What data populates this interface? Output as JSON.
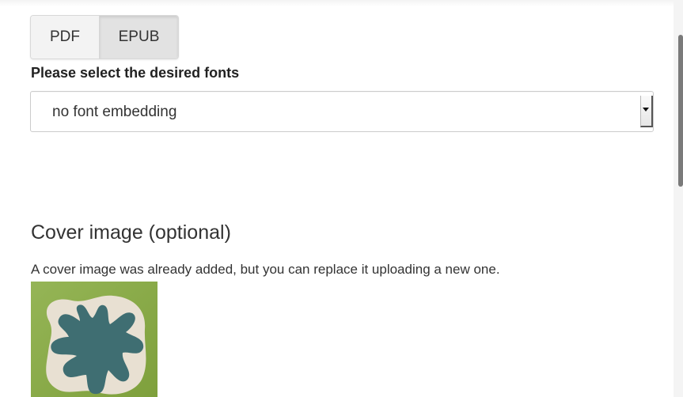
{
  "format_tabs": [
    {
      "label": "PDF",
      "active": false
    },
    {
      "label": "EPUB",
      "active": true
    }
  ],
  "fonts": {
    "label": "Please select the desired fonts",
    "selected": "no font embedding"
  },
  "cover": {
    "heading": "Cover image (optional)",
    "note": "A cover image was already added, but you can replace it uploading a new one."
  },
  "colors": {
    "thumb_green": "#8aaf48",
    "thumb_cream": "#e8e0d2",
    "thumb_teal": "#3f6e72"
  }
}
